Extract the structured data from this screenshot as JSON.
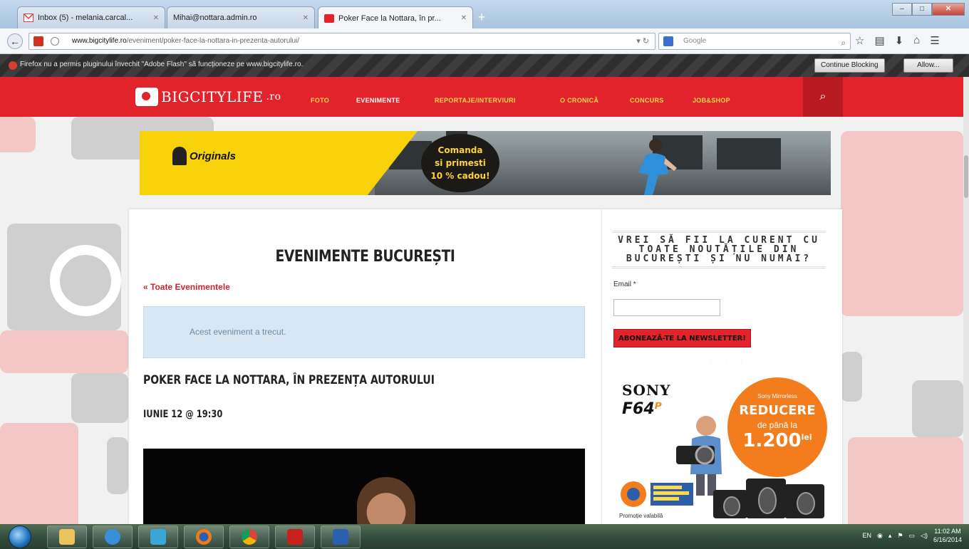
{
  "browser": {
    "tabs": [
      {
        "label": "Inbox (5) - melania.carcal...",
        "active": false
      },
      {
        "label": "Mihai@nottara.admin.ro",
        "active": false
      },
      {
        "label": "Poker Face la Nottara, în pr...",
        "active": true
      }
    ],
    "url_domain": "www.bigcitylife.ro",
    "url_path": "/eveniment/poker-face-la-nottara-in-prezenta-autorului/",
    "search_placeholder": "Google",
    "notification": {
      "text": "Firefox nu a permis pluginului învechit \"Adobe Flash\" să funcționeze pe www.bigcitylife.ro.",
      "continue_label": "Continue Blocking",
      "allow_label": "Allow..."
    }
  },
  "site": {
    "logo": "BIGCITYLIFE",
    "logo_suffix": ".ro",
    "menu": [
      "FOTO",
      "EVENIMENTE",
      "REPORTAJE/INTERVIURI",
      "O CRONICĂ",
      "CONCURS",
      "JOB&SHOP"
    ],
    "banner": {
      "brand": "Originals",
      "promo": [
        "Comanda",
        "si primesti",
        "10 % cadou!"
      ]
    },
    "page_title": "EVENIMENTE BUCUREȘTI",
    "back_link": "« Toate Evenimentele",
    "notice": "Acest eveniment a trecut.",
    "event_title": "POKER FACE LA NOTTARA, ÎN PREZENȚA AUTORULUI",
    "event_date": "IUNIE 12 @ 19:30",
    "sidebar": {
      "newsletter_title": "VREI SĂ FII LA CURENT CU TOATE NOUTĂȚILE DIN BUCUREȘTI ȘI NU NUMAI?",
      "email_label": "Email *",
      "subscribe_label": "ABONEAZĂ-TE LA NEWSLETTER!",
      "ad": {
        "brand": "SONY",
        "store": "F64",
        "headline": "Sony Mirrorless",
        "reduce": "REDUCERE",
        "upto": "de până la",
        "amount": "1.200",
        "unit": "lei",
        "promo": "Promoție valabilă"
      }
    }
  },
  "taskbar": {
    "lang": "EN",
    "time": "11:02 AM",
    "date": "6/16/2014"
  },
  "colors": {
    "brand_red": "#e3232b",
    "menu_yellow": "#ffd84d",
    "link_red": "#c9252c",
    "notice_bg": "#d7e7f3",
    "banner_yellow": "#f7d109",
    "sony_orange": "#f37c1c"
  }
}
